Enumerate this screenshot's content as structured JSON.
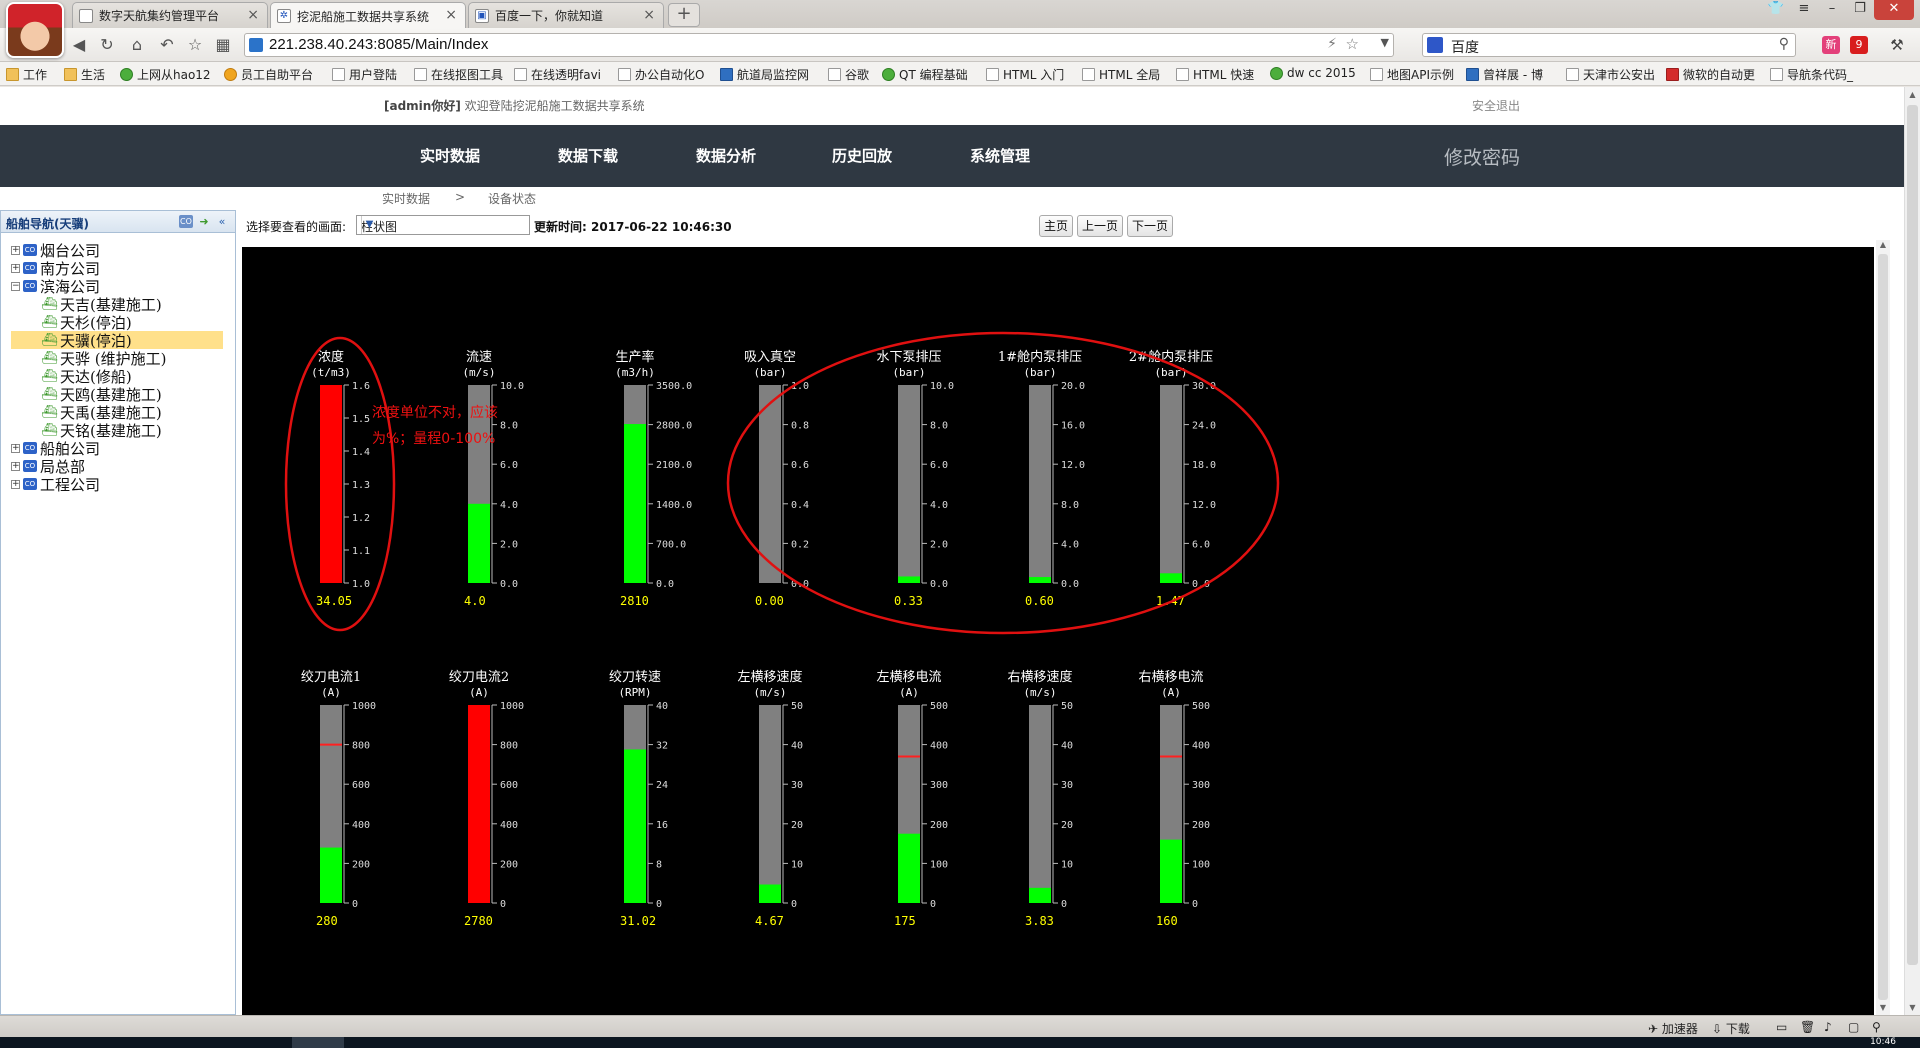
{
  "browser": {
    "tabs": [
      {
        "title": "数字天航集约管理平台",
        "active": false
      },
      {
        "title": "挖泥船施工数据共享系统",
        "active": true
      },
      {
        "title": "百度一下，你就知道",
        "active": false
      }
    ],
    "new_tab_label": "+",
    "url": "221.238.40.243:8085/Main/Index",
    "search_engine": "百度",
    "bookmarks": [
      {
        "label": "工作",
        "icon": "folder"
      },
      {
        "label": "生活",
        "icon": "folder"
      },
      {
        "label": "上网从hao12",
        "icon": "green"
      },
      {
        "label": "员工自助平台",
        "icon": "yellow"
      },
      {
        "label": "用户登陆",
        "icon": "page"
      },
      {
        "label": "在线抠图工具",
        "icon": "page"
      },
      {
        "label": "在线透明favi",
        "icon": "page"
      },
      {
        "label": "办公自动化O",
        "icon": "page"
      },
      {
        "label": "航道局监控网",
        "icon": "blue"
      },
      {
        "label": "谷歌",
        "icon": "page"
      },
      {
        "label": "QT 编程基础",
        "icon": "green"
      },
      {
        "label": "HTML 入门",
        "icon": "page"
      },
      {
        "label": "HTML 全局",
        "icon": "page"
      },
      {
        "label": "HTML 快速",
        "icon": "page"
      },
      {
        "label": "dw cc 2015",
        "icon": "green"
      },
      {
        "label": "地图API示例",
        "icon": "page"
      },
      {
        "label": "曾祥展 - 博",
        "icon": "blue"
      },
      {
        "label": "天津市公安出",
        "icon": "page"
      },
      {
        "label": "微软的自动更",
        "icon": "red"
      },
      {
        "label": "导航条代码_",
        "icon": "page"
      }
    ]
  },
  "header": {
    "user": "[admin你好]",
    "welcome": "欢迎登陆挖泥船施工数据共享系统",
    "logout": "安全退出"
  },
  "menu": {
    "items": [
      "实时数据",
      "数据下载",
      "数据分析",
      "历史回放",
      "系统管理"
    ],
    "change_password": "修改密码"
  },
  "breadcrumb": {
    "items": [
      "实时数据",
      "设备状态"
    ],
    "separator": ">"
  },
  "sidebar": {
    "title": "船舶导航(天骥)",
    "tree": [
      {
        "label": "烟台公司",
        "type": "company",
        "expanded": false
      },
      {
        "label": "南方公司",
        "type": "company",
        "expanded": false
      },
      {
        "label": "滨海公司",
        "type": "company",
        "expanded": true
      },
      {
        "label": "天吉(基建施工)",
        "type": "ship"
      },
      {
        "label": "天杉(停泊)",
        "type": "ship"
      },
      {
        "label": "天骥(停泊)",
        "type": "ship",
        "selected": true
      },
      {
        "label": "天骅 (维护施工)",
        "type": "ship"
      },
      {
        "label": "天达(修船)",
        "type": "ship"
      },
      {
        "label": "天鸥(基建施工)",
        "type": "ship"
      },
      {
        "label": "天禹(基建施工)",
        "type": "ship"
      },
      {
        "label": "天铭(基建施工)",
        "type": "ship"
      },
      {
        "label": "船舶公司",
        "type": "company",
        "expanded": false
      },
      {
        "label": "局总部",
        "type": "company",
        "expanded": false
      },
      {
        "label": "工程公司",
        "type": "company",
        "expanded": false
      }
    ]
  },
  "toolbar": {
    "view_label": "选择要查看的画面:",
    "view_value": "柱状图",
    "update_label": "更新时间:",
    "update_time": "2017-06-22 10:46:30",
    "home": "主页",
    "prev": "上一页",
    "next": "下一页"
  },
  "annotation": {
    "line1": "浓度单位不对，应该",
    "line2": "为%；量程0-100%"
  },
  "colors": {
    "menu_bg": "#2f3842",
    "gauge_track": "#808080",
    "fill_normal": "#00ff00",
    "fill_alarm": "#ff0000",
    "value_text": "#ffff00",
    "annotation": "#ee1111"
  },
  "chart_data": {
    "type": "bar",
    "gauges": [
      {
        "name": "浓度",
        "unit": "(t/m3)",
        "min": 1.0,
        "max": 1.6,
        "ticks": [
          "1.6",
          "1.5",
          "1.4",
          "1.3",
          "1.2",
          "1.1",
          "1.0"
        ],
        "value": 34.05,
        "display": "34.05",
        "color": "red",
        "fill": 1.0
      },
      {
        "name": "流速",
        "unit": "(m/s)",
        "min": 0,
        "max": 10,
        "ticks": [
          "10.0",
          "8.0",
          "6.0",
          "4.0",
          "2.0",
          "0.0"
        ],
        "value": 4.0,
        "display": "4.0",
        "color": "green"
      },
      {
        "name": "生产率",
        "unit": "(m3/h)",
        "min": 0,
        "max": 3500,
        "ticks": [
          "3500.0",
          "2800.0",
          "2100.0",
          "1400.0",
          "700.0",
          "0.0"
        ],
        "value": 2810,
        "display": "2810",
        "color": "green"
      },
      {
        "name": "吸入真空",
        "unit": "(bar)",
        "min": 0,
        "max": 1,
        "ticks": [
          "1.0",
          "0.8",
          "0.6",
          "0.4",
          "0.2",
          "0.0"
        ],
        "value": 0.0,
        "display": "0.00",
        "color": "green"
      },
      {
        "name": "水下泵排压",
        "unit": "(bar)",
        "min": 0,
        "max": 10,
        "ticks": [
          "10.0",
          "8.0",
          "6.0",
          "4.0",
          "2.0",
          "0.0"
        ],
        "value": 0.33,
        "display": "0.33",
        "color": "green"
      },
      {
        "name": "1#舱内泵排压",
        "unit": "(bar)",
        "min": 0,
        "max": 20,
        "ticks": [
          "20.0",
          "16.0",
          "12.0",
          "8.0",
          "4.0",
          "0.0"
        ],
        "value": 0.6,
        "display": "0.60",
        "color": "green"
      },
      {
        "name": "2#舱内泵排压",
        "unit": "(bar)",
        "min": 0,
        "max": 30,
        "ticks": [
          "30.0",
          "24.0",
          "18.0",
          "12.0",
          "6.0",
          "0.0"
        ],
        "value": 1.47,
        "display": "1.47",
        "color": "green"
      },
      {
        "name": "绞刀电流1",
        "unit": "(A)",
        "min": 0,
        "max": 1000,
        "ticks": [
          "1000",
          "800",
          "600",
          "400",
          "200",
          "0"
        ],
        "value": 280,
        "display": "280",
        "color": "green",
        "alarm": 800
      },
      {
        "name": "绞刀电流2",
        "unit": "(A)",
        "min": 0,
        "max": 1000,
        "ticks": [
          "1000",
          "800",
          "600",
          "400",
          "200",
          "0"
        ],
        "value": 2780,
        "display": "2780",
        "color": "red",
        "fill": 1.0
      },
      {
        "name": "绞刀转速",
        "unit": "(RPM)",
        "min": 0,
        "max": 40,
        "ticks": [
          "40",
          "32",
          "24",
          "16",
          "8",
          "0"
        ],
        "value": 31.02,
        "display": "31.02",
        "color": "green"
      },
      {
        "name": "左横移速度",
        "unit": "(m/s)",
        "min": 0,
        "max": 50,
        "ticks": [
          "50",
          "40",
          "30",
          "20",
          "10",
          "0"
        ],
        "value": 4.67,
        "display": "4.67",
        "color": "green"
      },
      {
        "name": "左横移电流",
        "unit": "(A)",
        "min": 0,
        "max": 500,
        "ticks": [
          "500",
          "400",
          "300",
          "200",
          "100",
          "0"
        ],
        "value": 175,
        "display": "175",
        "color": "green",
        "alarm": 370
      },
      {
        "name": "右横移速度",
        "unit": "(m/s)",
        "min": 0,
        "max": 50,
        "ticks": [
          "50",
          "40",
          "30",
          "20",
          "10",
          "0"
        ],
        "value": 3.83,
        "display": "3.83",
        "color": "green"
      },
      {
        "name": "右横移电流",
        "unit": "(A)",
        "min": 0,
        "max": 500,
        "ticks": [
          "500",
          "400",
          "300",
          "200",
          "100",
          "0"
        ],
        "value": 160,
        "display": "160",
        "color": "green",
        "alarm": 370
      }
    ],
    "annotation_circles": 2
  },
  "statusbar": {
    "accelerator": "加速器",
    "download": "下载"
  },
  "taskbar": {
    "clock": "10:46"
  }
}
